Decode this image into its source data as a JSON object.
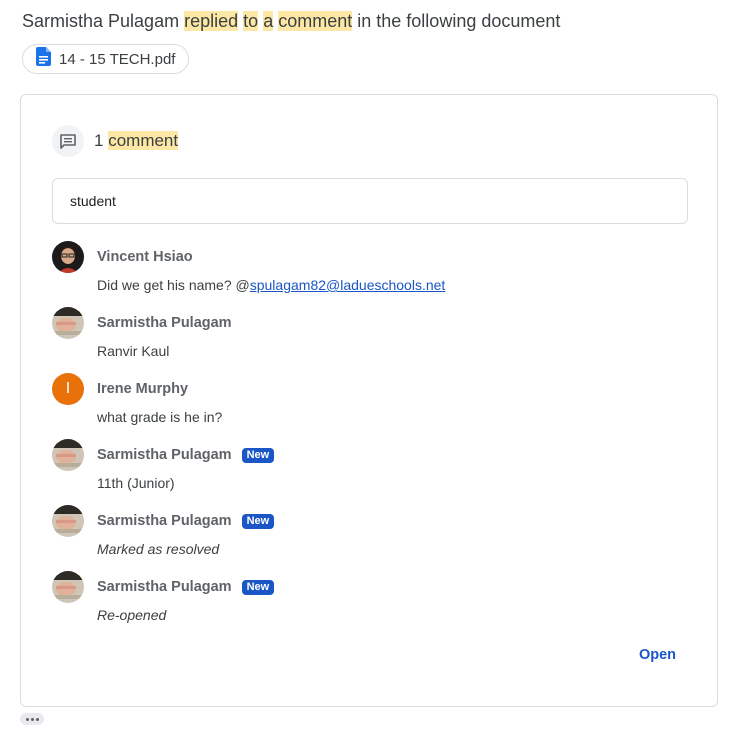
{
  "headline": {
    "actor": "Sarmistha Pulagam",
    "w_replied": "replied",
    "w_to": "to",
    "w_a": "a",
    "w_comment": "comment",
    "tail": "in the following document"
  },
  "document": {
    "name": "14 - 15 TECH.pdf",
    "icon": "document-icon"
  },
  "thread": {
    "count": "1",
    "count_word": "comment",
    "quoted_text": "student",
    "comments": [
      {
        "author": "Vincent Hsiao",
        "text": "Did we get his name? @",
        "mention": "spulagam82@ladueschools.net",
        "avatar": "photo"
      },
      {
        "author": "Sarmistha Pulagam",
        "text": "Ranvir Kaul",
        "avatar": "photo"
      },
      {
        "author": "Irene Murphy",
        "text": "what grade is he in?",
        "avatar": "initial",
        "initial": "I",
        "avatar_color": "#e8710a"
      },
      {
        "author": "Sarmistha Pulagam",
        "badge": "New",
        "text": "11th (Junior)",
        "avatar": "photo"
      },
      {
        "author": "Sarmistha Pulagam",
        "badge": "New",
        "text": "Marked as resolved",
        "avatar": "photo"
      },
      {
        "author": "Sarmistha Pulagam",
        "badge": "New",
        "text": "Re-opened",
        "avatar": "photo"
      }
    ],
    "open_label": "Open"
  },
  "colors": {
    "accent": "#1a56c5",
    "highlight": "#fce8a4"
  }
}
